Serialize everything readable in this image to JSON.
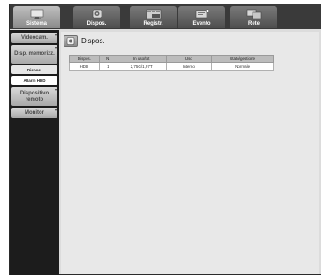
{
  "topnav": {
    "tabs": [
      {
        "label": "Sistema",
        "icon": "monitor-icon",
        "active": true
      },
      {
        "label": "Dispos.",
        "icon": "camera-icon",
        "active": false
      },
      {
        "label": "Registr.",
        "icon": "recording-icon",
        "active": false
      },
      {
        "label": "Evento",
        "icon": "event-icon",
        "active": false
      },
      {
        "label": "Rete",
        "icon": "network-icon",
        "active": false
      }
    ]
  },
  "sidebar": {
    "items": [
      {
        "label": "Videocam."
      },
      {
        "label": "Disp. memorizz."
      },
      {
        "label": "Dispos."
      },
      {
        "label": "Allarm HDD"
      },
      {
        "label": "Dispositivo remoto"
      },
      {
        "label": "Monitor"
      }
    ]
  },
  "main": {
    "title": "Dispos.",
    "table": {
      "headers": [
        "Dispos.",
        "N.",
        "In uso/tot",
        "Uso",
        "Stato/gestione"
      ],
      "rows": [
        [
          "HDD",
          "1",
          "2,75G/1,97T",
          "Interno",
          "Normale"
        ]
      ]
    }
  },
  "colors": {
    "topbar": "#3a3a3a",
    "sidebar": "#1c1c1c",
    "content": "#e8e8e8",
    "active_tab": "#a6a6a6"
  }
}
